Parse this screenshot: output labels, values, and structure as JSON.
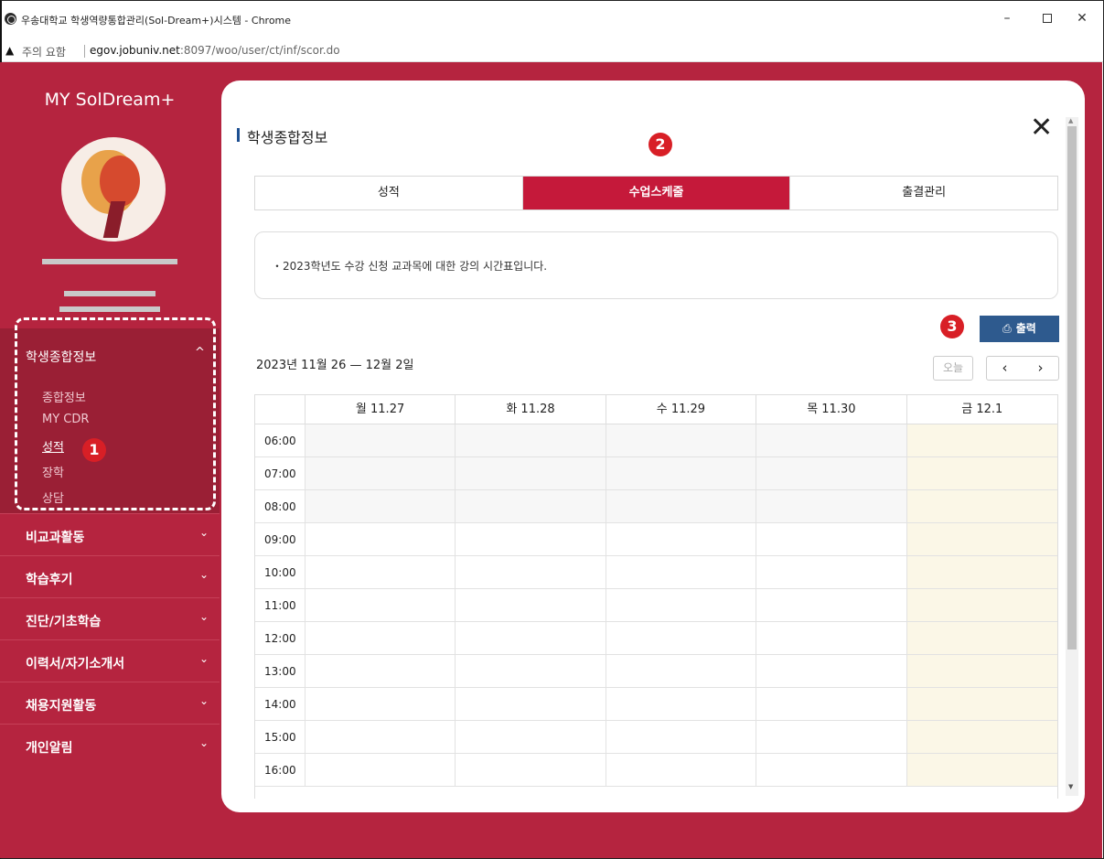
{
  "window": {
    "title": "우송대학교 학생역량통합관리(Sol-Dream+)시스템 - Chrome",
    "controls": {
      "minimize": "–",
      "maximize": "",
      "close": "✕"
    }
  },
  "address_bar": {
    "warning_icon": "▲",
    "warning_text": "주의 요함",
    "url_host": "egov.jobuniv.net",
    "url_path": ":8097/woo/user/ct/inf/scor.do"
  },
  "colors": {
    "brand": "#b5243f",
    "tab_active": "#c5193a",
    "print_button": "#2e5a8e",
    "marker": "#d81f26",
    "today_column": "#fbf7e7"
  },
  "sidebar": {
    "brand": "MY SolDream+",
    "menu_open": {
      "label": "학생종합정보",
      "chevron": "^",
      "sub_items": [
        "종합정보",
        "MY CDR",
        "성적",
        "장학",
        "상담"
      ],
      "active_index": 2
    },
    "menu_items": [
      {
        "label": "비교과활동",
        "chevron": "⌄"
      },
      {
        "label": "학습후기",
        "chevron": "⌄"
      },
      {
        "label": "진단/기초학습",
        "chevron": "⌄"
      },
      {
        "label": "이력서/자기소개서",
        "chevron": "⌄"
      },
      {
        "label": "채용지원활동",
        "chevron": "⌄"
      },
      {
        "label": "개인알림",
        "chevron": "⌄"
      }
    ]
  },
  "markers": [
    "1",
    "2",
    "3"
  ],
  "modal": {
    "title": "학생종합정보",
    "close_icon": "✕",
    "tabs": [
      {
        "label": "성적",
        "active": false
      },
      {
        "label": "수업스케줄",
        "active": true
      },
      {
        "label": "출결관리",
        "active": false
      }
    ],
    "notice": "・2023학년도 수강 신청 교과목에 대한 강의 시간표입니다.",
    "print_label": "출력",
    "print_icon": "⎙",
    "date_range": "2023년 11월 26 — 12월 2일",
    "today_label": "오늘",
    "prev_icon": "‹",
    "next_icon": "›",
    "calendar": {
      "days": [
        "월 11.27",
        "화 11.28",
        "수 11.29",
        "목 11.30",
        "금 12.1"
      ],
      "times": [
        "06:00",
        "07:00",
        "08:00",
        "09:00",
        "10:00",
        "11:00",
        "12:00",
        "13:00",
        "14:00",
        "15:00",
        "16:00"
      ],
      "shaded_times": [
        "06:00",
        "07:00",
        "08:00"
      ],
      "today_day": "금 12.1"
    }
  }
}
